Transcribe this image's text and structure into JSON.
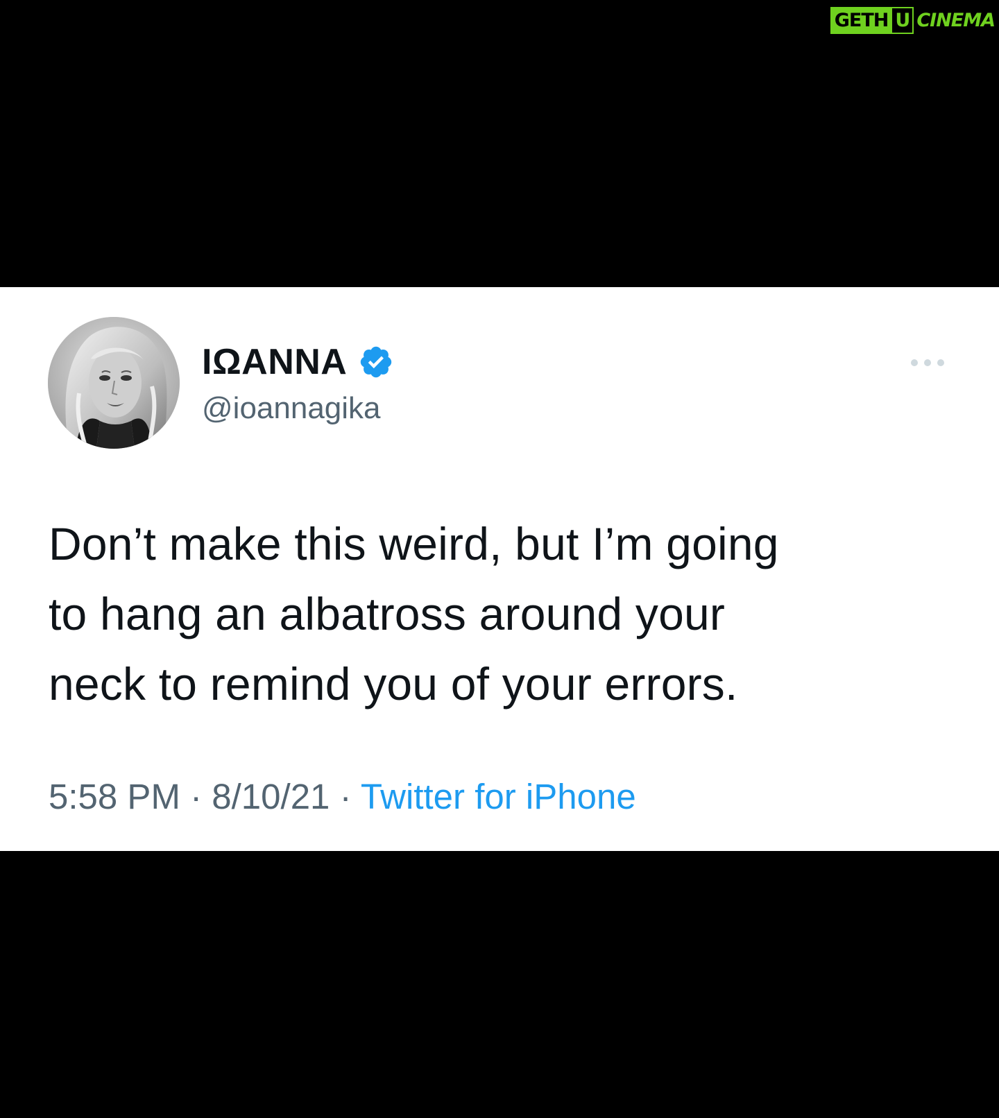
{
  "watermark": {
    "part1": "GETH",
    "part2": "U",
    "part3": "CINEMA",
    "color": "#6fd11f"
  },
  "tweet": {
    "author_name": "ΙΩΑΝΝΑ",
    "handle": "@ioannagika",
    "verified": true,
    "text_lines": [
      "Don’t make this weird, but I’m going",
      "to hang an albatross around your",
      "neck to remind you of your errors."
    ],
    "time": "5:58 PM",
    "date": "8/10/21",
    "separator": "·",
    "source": "Twitter for iPhone"
  },
  "icons": {
    "verified": "verified-badge-icon",
    "more": "more-options-icon"
  },
  "colors": {
    "background": "#000000",
    "card": "#ffffff",
    "text_primary": "#0f1419",
    "text_secondary": "#536471",
    "accent": "#1d9bf0"
  }
}
